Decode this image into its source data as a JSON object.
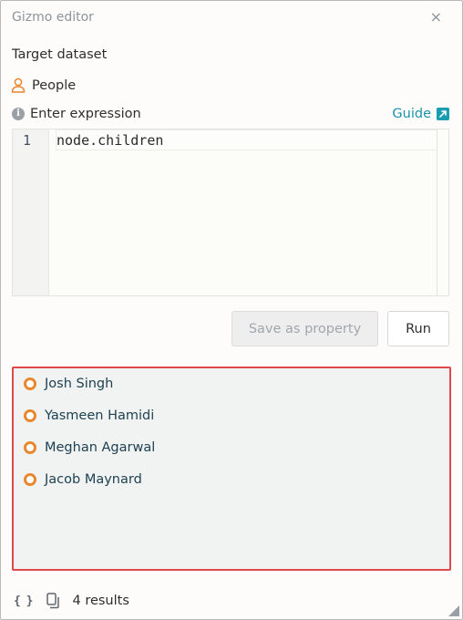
{
  "header": {
    "title": "Gizmo editor",
    "close_glyph": "×"
  },
  "target": {
    "label": "Target dataset",
    "dataset_name": "People",
    "dataset_icon": "person-icon"
  },
  "expression": {
    "label": "Enter expression",
    "guide_label": "Guide",
    "line_number": "1",
    "code": "node.children"
  },
  "buttons": {
    "save_label": "Save as property",
    "run_label": "Run"
  },
  "results": {
    "items": [
      {
        "label": "Josh Singh"
      },
      {
        "label": "Yasmeen Hamidi"
      },
      {
        "label": "Meghan Agarwal"
      },
      {
        "label": "Jacob Maynard"
      }
    ],
    "count_label": "4 results",
    "highlight_color": "#e0484c",
    "node_color": "#e9872f"
  },
  "footer": {
    "braces_glyph": "{ }"
  },
  "colors": {
    "accent": "#1993a8",
    "text": "#2e2e2e",
    "muted": "#8d949a"
  }
}
